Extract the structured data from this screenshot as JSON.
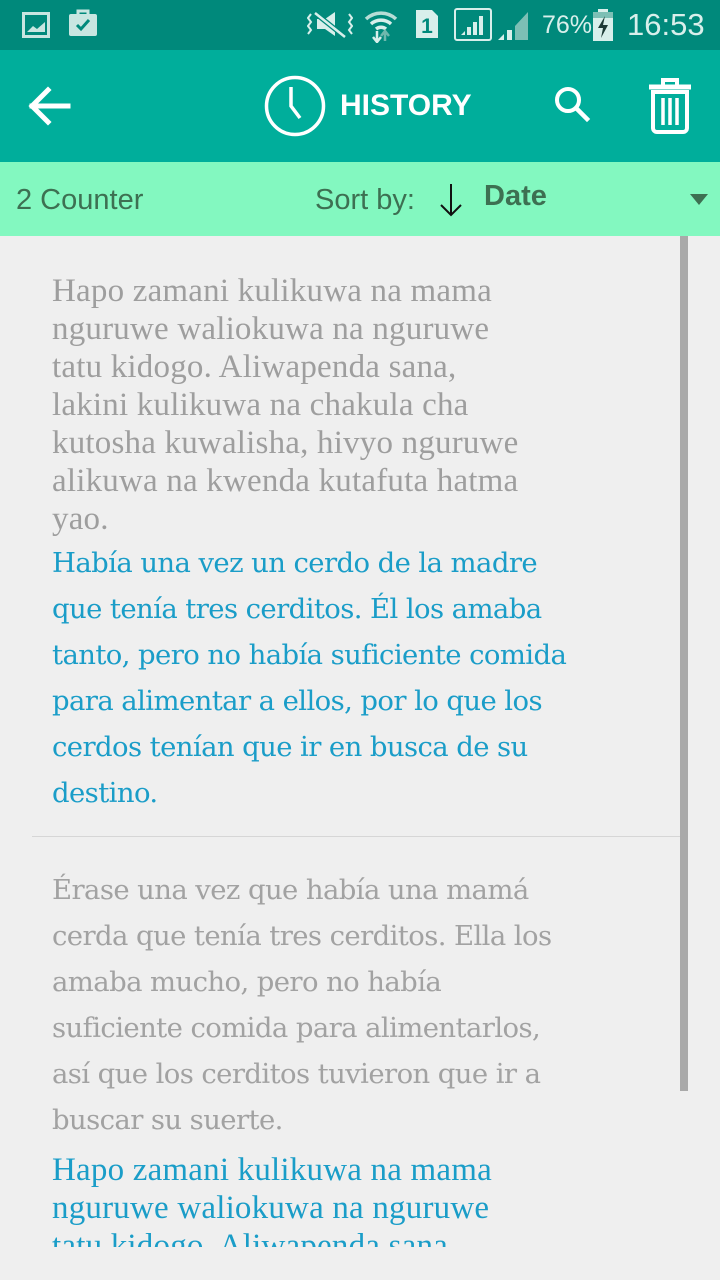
{
  "status_bar": {
    "left_icons": [
      "gallery-notification-icon",
      "task-notification-icon"
    ],
    "right_icons": [
      "vibrate-mute-icon",
      "wifi-icon",
      "sim1-icon",
      "signal-icon",
      "signal-2-icon",
      "battery-charging-icon"
    ],
    "battery_percent": "76%",
    "time": "16:53"
  },
  "app_bar": {
    "back_icon": "arrow-left-icon",
    "title_icon": "clock-icon",
    "title": "HISTORY",
    "search_icon": "search-icon",
    "delete_icon": "trash-icon"
  },
  "sort_bar": {
    "counter": "2 Counter",
    "sort_label": "Sort by:",
    "sort_direction_icon": "arrow-down-icon",
    "sort_value": "Date"
  },
  "colors": {
    "status_bar": "#00897b",
    "app_bar": "#00ae9b",
    "sort_bar": "#83f8c0",
    "source_text": "#9e9e9e",
    "translation_text": "#1a9dc8",
    "background": "#efefef"
  },
  "history": [
    {
      "source_lines": [
        "Hapo zamani kulikuwa na mama",
        "nguruwe waliokuwa na nguruwe",
        "tatu kidogo. Aliwapenda sana,",
        "lakini kulikuwa na chakula cha",
        "kutosha kuwalisha, hivyo nguruwe",
        "alikuwa na kwenda kutafuta hatma",
        "yao."
      ],
      "translation_lines": [
        "Había una vez un cerdo de la madre",
        "que tenía tres cerditos. Él los amaba",
        "tanto, pero no había suficiente comida",
        "para alimentar a ellos, por lo que los",
        "cerdos tenían que ir en busca de su",
        "destino."
      ]
    },
    {
      "source_lines": [
        "Érase una vez que había una mamá",
        "cerda que tenía tres cerditos. Ella los",
        "amaba mucho, pero no había",
        "suficiente comida para alimentarlos,",
        "así que los cerditos tuvieron que ir a",
        "buscar su suerte."
      ],
      "translation_lines": [
        "Hapo zamani kulikuwa na mama",
        "nguruwe waliokuwa na nguruwe",
        "tatu kidogo. Aliwapenda sana,"
      ]
    }
  ]
}
